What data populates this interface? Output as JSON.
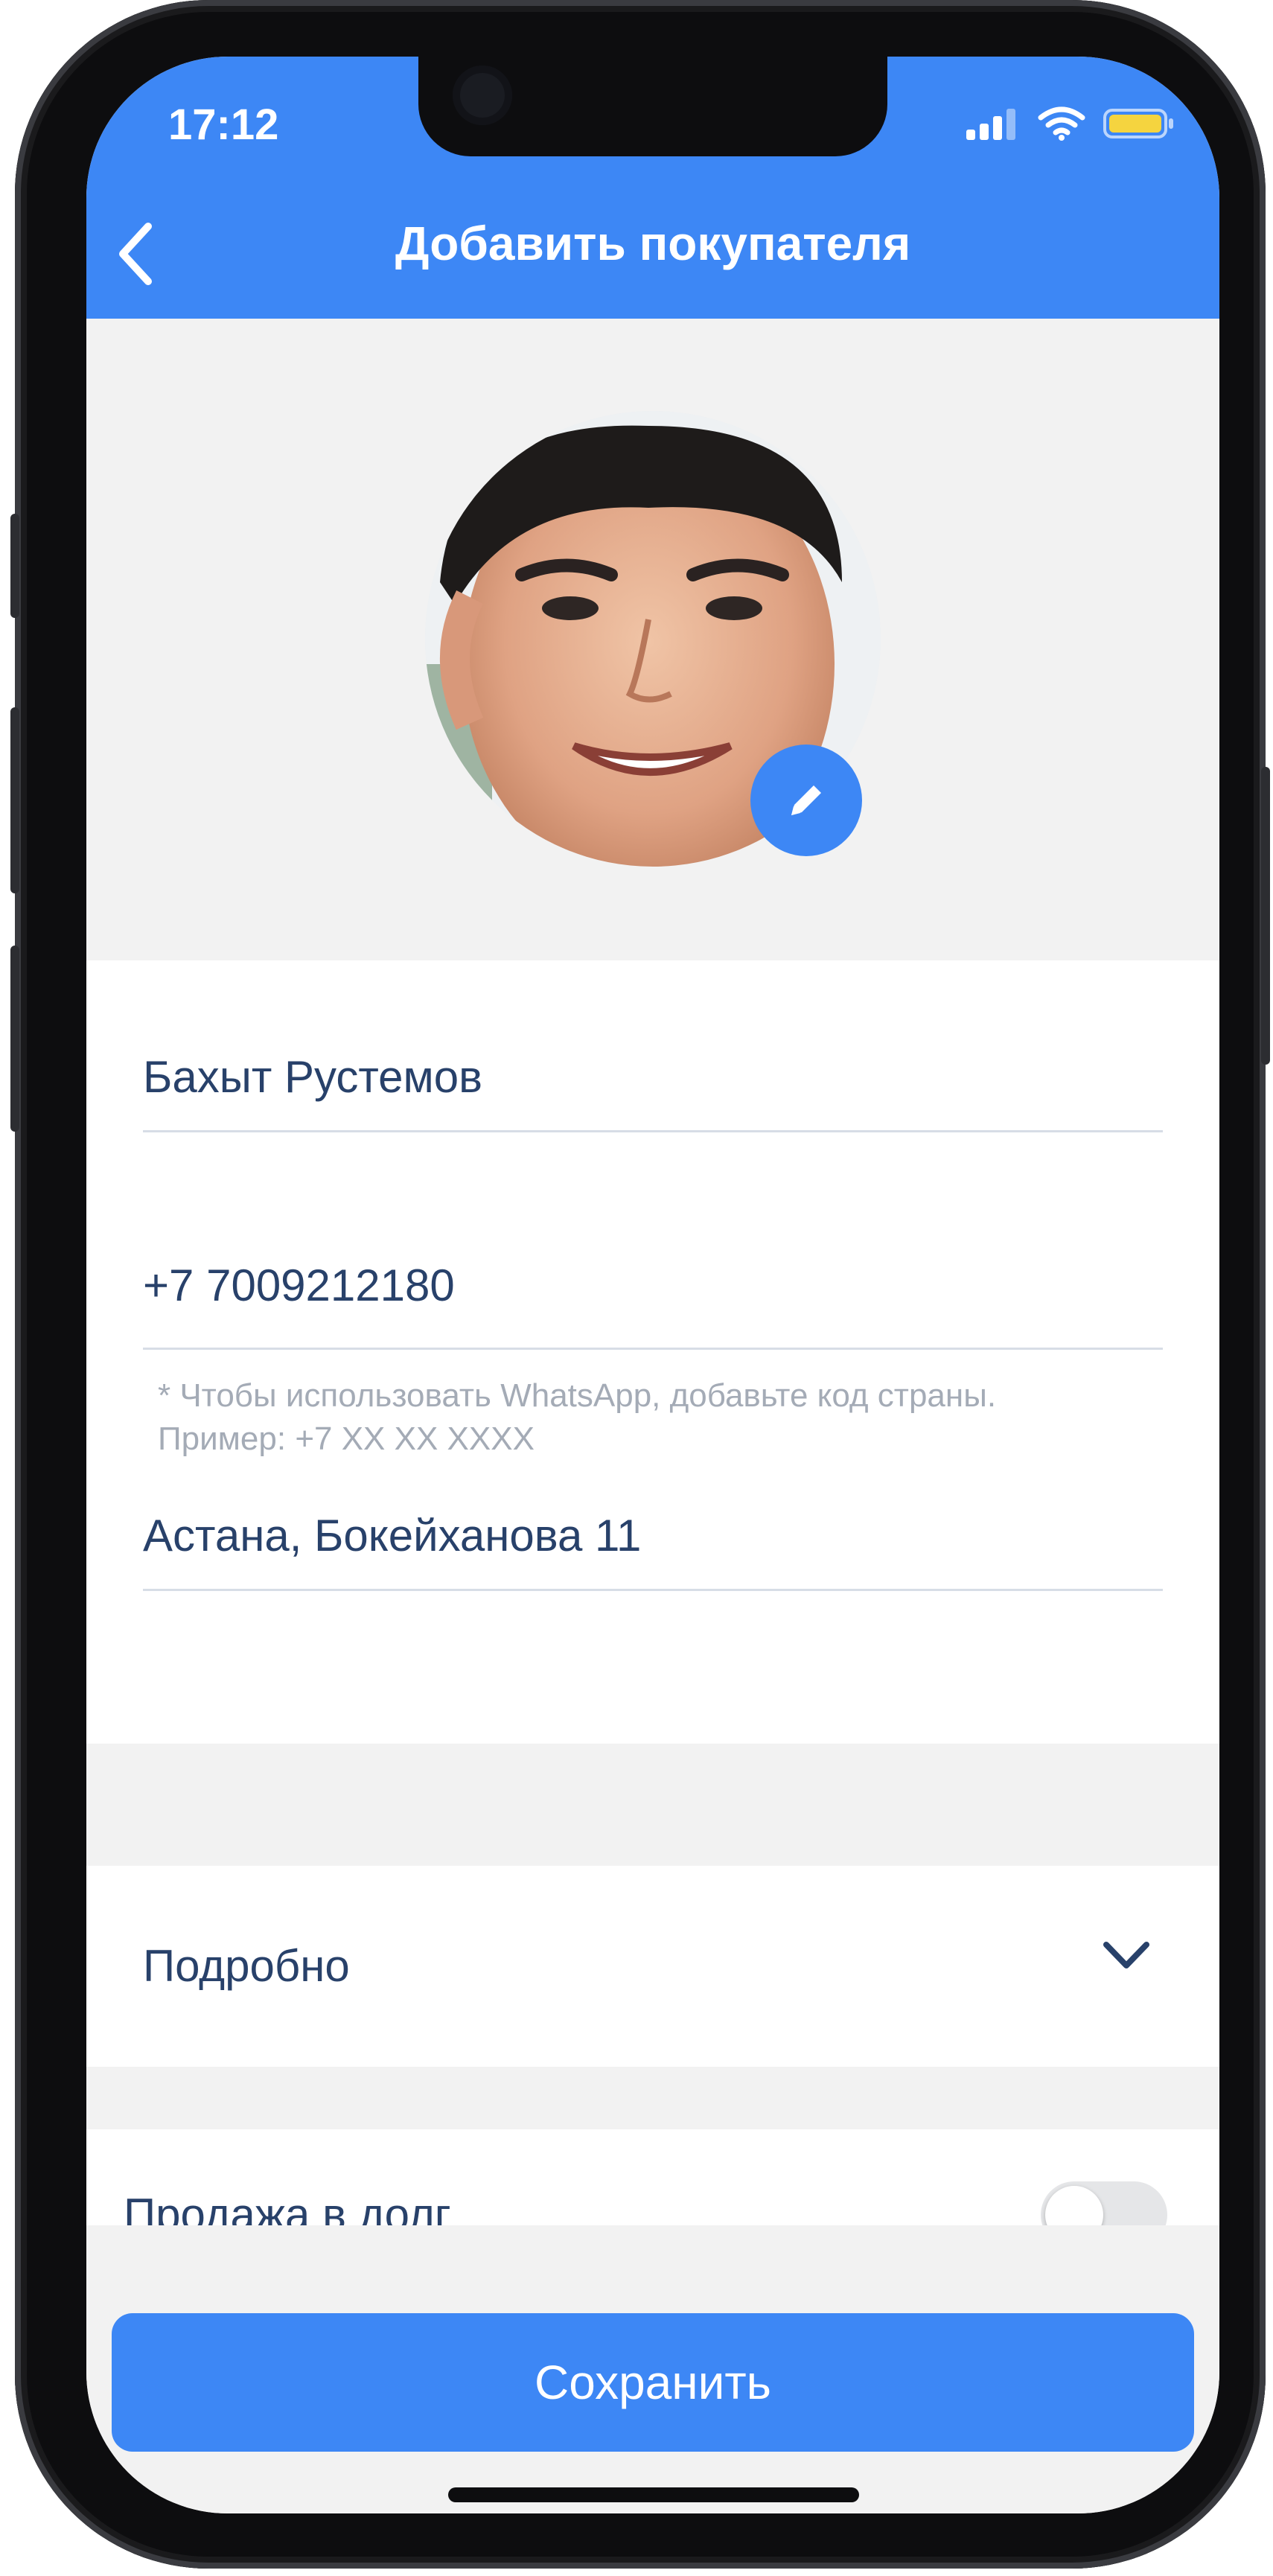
{
  "status": {
    "time": "17:12",
    "signal_icon": "signal-bars-icon",
    "wifi_icon": "wifi-icon",
    "battery_icon": "battery-icon",
    "battery_color": "#f5d43f"
  },
  "header": {
    "title": "Добавить покупателя",
    "back_icon": "chevron-left-icon",
    "background": "#3d87f5"
  },
  "avatar": {
    "edit_icon": "pencil-icon"
  },
  "form": {
    "name": "Бахыт Рустемов",
    "phone": "+7 7009212180",
    "phone_hint": "* Чтобы использовать WhatsApp, добавьте код страны. Пример: +7 XX XX XXXX",
    "address": "Астана, Бокейханова 11"
  },
  "details": {
    "label": "Подробно",
    "chevron_icon": "chevron-down-icon"
  },
  "debt": {
    "label": "Продажа в долг",
    "toggle_on": false
  },
  "footer": {
    "save_label": "Сохранить"
  }
}
